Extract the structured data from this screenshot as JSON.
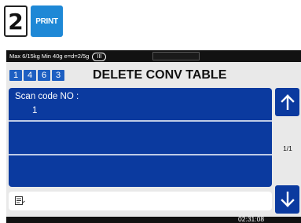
{
  "step": {
    "number": "2"
  },
  "print_button": {
    "label": "PRINT"
  },
  "status_bar": {
    "weight_info": "Max 6/15kg Min 40g e=d=2/5g",
    "range_badge": "III"
  },
  "header": {
    "code_digits": [
      "1",
      "4",
      "6",
      "3"
    ],
    "title": "DELETE CONV TABLE"
  },
  "list": {
    "rows": [
      {
        "label": "Scan code NO :",
        "value": "1"
      },
      {
        "label": "",
        "value": ""
      },
      {
        "label": "",
        "value": ""
      }
    ]
  },
  "pager": {
    "page": "1/1"
  },
  "icons": {
    "up": "arrow-up-icon",
    "down": "arrow-down-icon",
    "memo": "memo-icon"
  },
  "clock": {
    "time": "02:31:08"
  },
  "colors": {
    "accent_blue": "#0b3a9f",
    "print_blue": "#1e88d6",
    "digit_blue": "#1d5fc2"
  }
}
